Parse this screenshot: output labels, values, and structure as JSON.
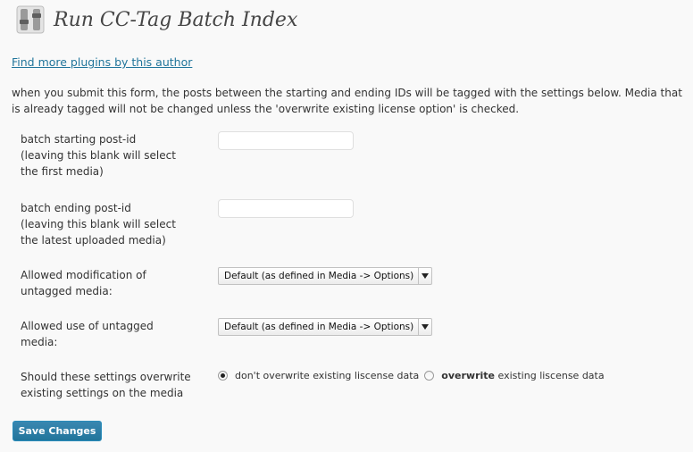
{
  "header": {
    "title": "Run CC-Tag Batch Index",
    "icon": "plugin-settings-icon"
  },
  "author_link": "Find more plugins by this author",
  "intro": "when you submit this form, the posts between the starting and ending IDs will be tagged with the settings below. Media that is already tagged will not be changed unless the 'overwrite existing license option' is checked.",
  "form": {
    "start_label": [
      "batch starting post-id",
      "(leaving this blank will select",
      "the first media)"
    ],
    "start_value": "",
    "end_label": [
      "batch ending post-id",
      "(leaving this blank will select",
      "the latest uploaded media)"
    ],
    "end_value": "",
    "modification_label": [
      "Allowed modification of",
      "untagged media:"
    ],
    "modification_selected": "Default (as defined in Media -> Options)",
    "use_label": [
      "Allowed use of untagged",
      "media:"
    ],
    "use_selected": "Default (as defined in Media -> Options)",
    "overwrite_label": [
      "Should these settings overwrite",
      "existing settings on the media"
    ],
    "overwrite_options": {
      "keep": "don't overwrite existing liscense data",
      "overwrite_bold": "overwrite",
      "overwrite_rest": " existing liscense data",
      "selected": "keep"
    }
  },
  "save_label": "Save Changes",
  "colors": {
    "link": "#21759b",
    "button": "#21759b",
    "background": "#f9f9f9"
  }
}
